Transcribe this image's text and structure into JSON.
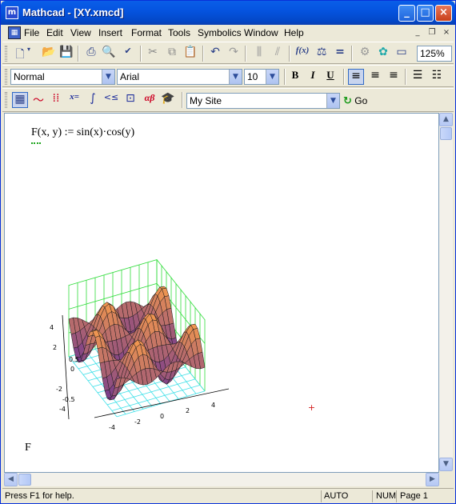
{
  "window": {
    "title": "Mathcad - [XY.xmcd]",
    "app_icon_glyph": "m",
    "buttons": {
      "minimize": "_",
      "maximize": "□",
      "close": "×"
    },
    "close_color": "#c8401a",
    "titlebar_color": "#0554e0"
  },
  "menu": {
    "items": [
      "File",
      "Edit",
      "View",
      "Insert",
      "Format",
      "Tools",
      "Symbolics",
      "Window",
      "Help"
    ],
    "mdi": {
      "minimize": "_",
      "restore": "❐",
      "close": "×"
    }
  },
  "toolbar_standard": {
    "icons": [
      "new-icon",
      "open-icon",
      "save-icon",
      "print-icon",
      "print-preview-icon",
      "spell-check-icon",
      "cut-icon",
      "copy-icon",
      "paste-icon",
      "undo-icon",
      "redo-icon",
      "align-icon",
      "align-down-icon",
      "insert-function-icon",
      "insert-unit-icon",
      "calculate-icon",
      "component-icon",
      "resource-icon",
      "window-icon"
    ],
    "zoom": "125%"
  },
  "toolbar_formatting": {
    "style": "Normal",
    "font": "Arial",
    "size": "10",
    "bold": "B",
    "italic": "I",
    "underline": "U"
  },
  "toolbar_math": {
    "address": "My Site",
    "go_label": "Go"
  },
  "document": {
    "definition": "F(x, y) := sin(x)·cos(y)",
    "plot_label": "F",
    "plot": {
      "z_ticks": [
        "4",
        "2",
        "0.5",
        "0",
        "-2",
        "-0.5",
        "-4"
      ],
      "x_ticks": [
        "-4",
        "-2",
        "0",
        "2",
        "4"
      ],
      "surface_color": "#d9786a",
      "grid_color": "#2fdc3a",
      "axis_color": "#3ee0e8"
    }
  },
  "status": {
    "help": "Press F1 for help.",
    "mode": "AUTO",
    "num": "NUM",
    "page": "Page 1"
  }
}
